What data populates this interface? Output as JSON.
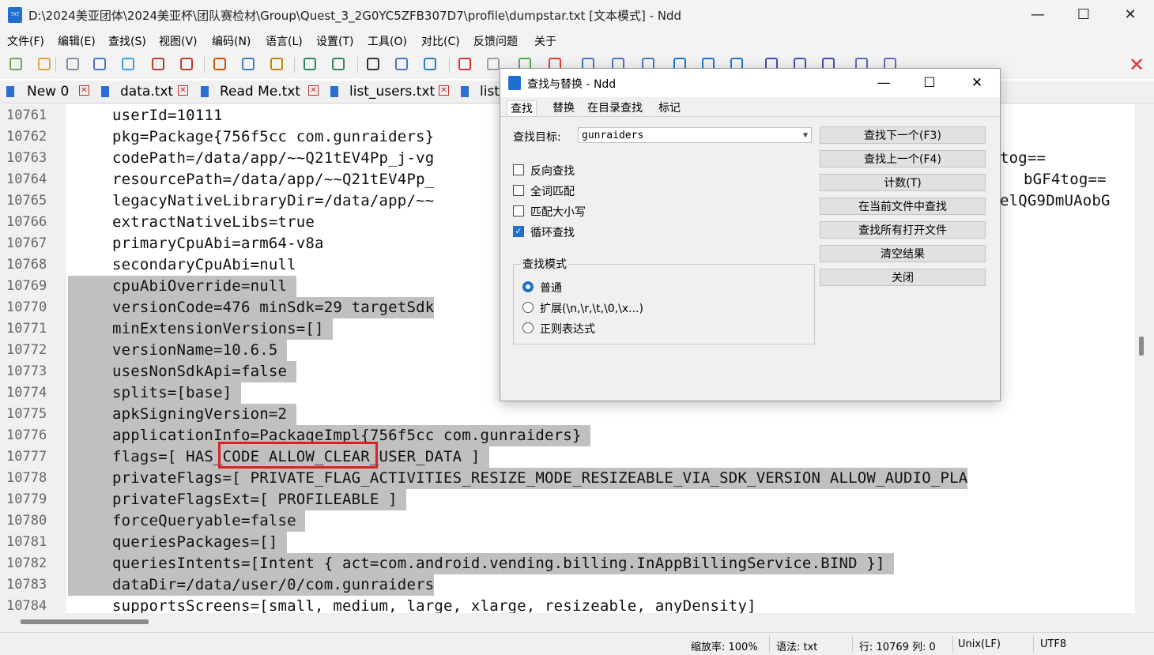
{
  "window": {
    "title": "D:\\2024美亚团体\\2024美亚杯\\团队赛检材\\Group\\Quest_3_2G0YC5ZFB307D7\\profile\\dumpstar.txt [文本模式] - Ndd",
    "icon_text": "TXT",
    "minimize": "—",
    "maximize": "☐",
    "close": "✕"
  },
  "menu": [
    "文件(F)",
    "编辑(E)",
    "查找(S)",
    "视图(V)",
    "编码(N)",
    "语言(L)",
    "设置(T)",
    "工具(O)",
    "对比(C)",
    "反馈问题",
    "关于"
  ],
  "toolbar": {
    "icons": [
      "new-icon",
      "open-icon",
      "save-icon",
      "save-all-icon",
      "reload-icon",
      "close-icon",
      "close-all-icon",
      "cut-icon",
      "copy-icon",
      "paste-icon",
      "undo-icon",
      "redo-icon",
      "find-icon",
      "replace-icon",
      "goto-icon",
      "mark-icon",
      "clear-mark-icon",
      "zoom-in-icon",
      "zoom-out-icon",
      "wrap-icon",
      "show-all-icon",
      "indent-icon",
      "prev-icon",
      "next-icon",
      "link-icon",
      "compare-icon",
      "dir-compare-icon",
      "bin-compare-icon",
      "hex-icon",
      "text-icon"
    ],
    "colors": [
      "#6aa84f",
      "#e6a23c",
      "#7f8fa6",
      "#4a78c2",
      "#3aa0e0",
      "#c0392b",
      "#c0392b",
      "#d35400",
      "#4a78c2",
      "#b8860b",
      "#2e8b57",
      "#2e8b57",
      "#333333",
      "#4a78c2",
      "#2c7fb8",
      "#e03030",
      "#9e9e9e",
      "#4caf50",
      "#e53935",
      "#4a78c2",
      "#4a78c2",
      "#4a78c2",
      "#1976d2",
      "#1976d2",
      "#1976d2",
      "#3f51b5",
      "#3f51b5",
      "#3f51b5",
      "#5c6bc0",
      "#5c6bc0"
    ],
    "close_doc": "✕"
  },
  "tabs": [
    {
      "label": "New 0"
    },
    {
      "label": "data.txt"
    },
    {
      "label": "Read Me.txt"
    },
    {
      "label": "list_users.txt"
    },
    {
      "label": "list_"
    }
  ],
  "editor": {
    "lines": [
      {
        "n": "10761",
        "text": "userId=10111",
        "sel": false
      },
      {
        "n": "10762",
        "text": "pkg=Package{756f5cc com.gunraiders}",
        "sel": false
      },
      {
        "n": "10763",
        "text": "codePath=/data/app/~~Q21tEV4Pp_j-vg",
        "sel": false
      },
      {
        "n": "10764",
        "text": "resourcePath=/data/app/~~Q21tEV4Pp_",
        "sel": false
      },
      {
        "n": "10765",
        "text": "legacyNativeLibraryDir=/data/app/~~",
        "sel": false
      },
      {
        "n": "10766",
        "text": "extractNativeLibs=true",
        "sel": false
      },
      {
        "n": "10767",
        "text": "primaryCpuAbi=arm64-v8a",
        "sel": false
      },
      {
        "n": "10768",
        "text": "secondaryCpuAbi=null",
        "sel": false
      },
      {
        "n": "10769",
        "text": "cpuAbiOverride=null ",
        "sel": true
      },
      {
        "n": "10770",
        "text": "versionCode=476 minSdk=29 targetSdk",
        "sel": true
      },
      {
        "n": "10771",
        "text": "minExtensionVersions=[] ",
        "sel": true
      },
      {
        "n": "10772",
        "text": "versionName=10.6.5 ",
        "sel": true
      },
      {
        "n": "10773",
        "text": "usesNonSdkApi=false ",
        "sel": true
      },
      {
        "n": "10774",
        "text": "splits=[base] ",
        "sel": true
      },
      {
        "n": "10775",
        "text": "apkSigningVersion=2 ",
        "sel": true
      },
      {
        "n": "10776",
        "text": "applicationInfo=PackageImpl{756f5cc com.gunraiders} ",
        "sel": true
      },
      {
        "n": "10777",
        "text": "flags=[ HAS_CODE ALLOW_CLEAR_USER_DATA ] ",
        "sel": true
      },
      {
        "n": "10778",
        "text": "privateFlags=[ PRIVATE_FLAG_ACTIVITIES_RESIZE_MODE_RESIZEABLE_VIA_SDK_VERSION ALLOW_AUDIO_PLA",
        "sel": true
      },
      {
        "n": "10779",
        "text": "privateFlagsExt=[ PROFILEABLE ] ",
        "sel": true
      },
      {
        "n": "10780",
        "text": "forceQueryable=false ",
        "sel": true
      },
      {
        "n": "10781",
        "text": "queriesPackages=[] ",
        "sel": true
      },
      {
        "n": "10782",
        "text": "queriesIntents=[Intent { act=com.android.vending.billing.InAppBillingService.BIND }] ",
        "sel": true
      },
      {
        "n": "10783",
        "text": "dataDir=/data/user/0/com.gunraiders",
        "sel": true
      },
      {
        "n": "10784",
        "text": "supportsScreens=[small, medium, large, xlarge, resizeable, anyDensity]",
        "sel": false
      }
    ],
    "right_fragments": [
      {
        "text": "tog==",
        "line": 2
      },
      {
        "text": "bGF4tog==",
        "line": 3
      },
      {
        "text": "elQG9DmUAobG",
        "line": 4
      }
    ]
  },
  "status": {
    "zoom": "缩放率: 100%",
    "syntax": "语法: txt",
    "position": "行: 10769 列: 0",
    "eol": "Unix(LF)",
    "encoding": "UTF8"
  },
  "dialog": {
    "title": "查找与替换 - Ndd",
    "tabs": [
      "查找",
      "替换",
      "在目录查找",
      "标记"
    ],
    "target_label": "查找目标:",
    "target_value": "gunraiders",
    "options": [
      {
        "label": "反向查找",
        "checked": false
      },
      {
        "label": "全词匹配",
        "checked": false
      },
      {
        "label": "匹配大小写",
        "checked": false
      },
      {
        "label": "循环查找",
        "checked": true
      }
    ],
    "mode_title": "查找模式",
    "modes": [
      {
        "label": "普通",
        "selected": true
      },
      {
        "label": "扩展(\\n,\\r,\\t,\\0,\\x...)",
        "selected": false
      },
      {
        "label": "正则表达式",
        "selected": false
      }
    ],
    "buttons": [
      "查找下一个(F3)",
      "查找上一个(F4)",
      "计数(T)",
      "在当前文件中查找",
      "查找所有打开文件",
      "清空结果",
      "关闭"
    ],
    "checkmark": "✓"
  }
}
